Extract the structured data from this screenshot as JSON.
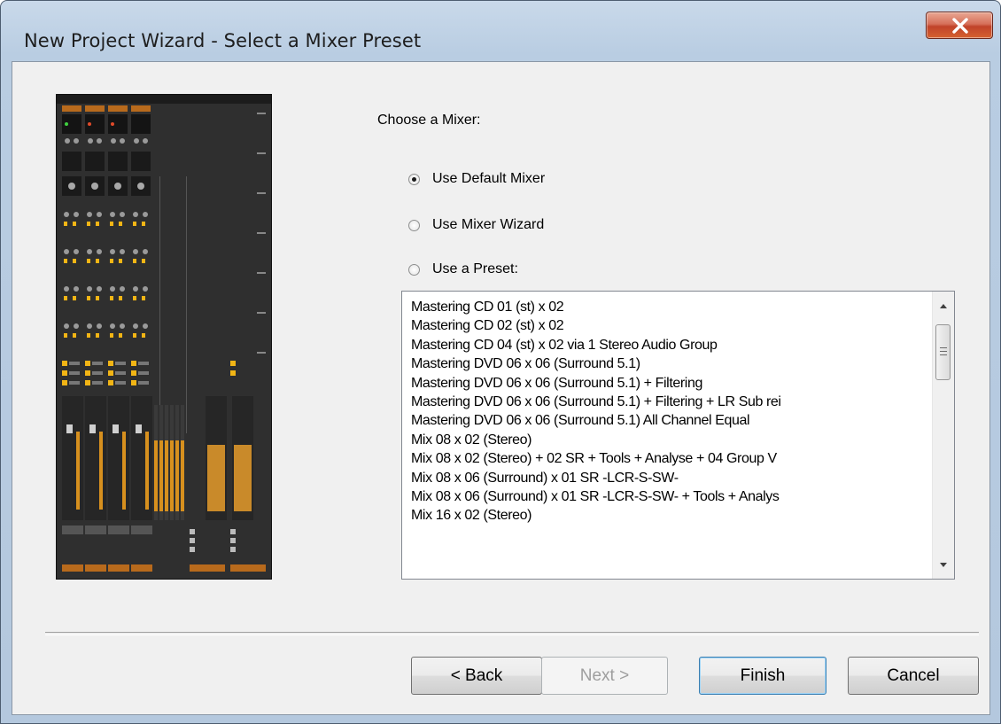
{
  "window": {
    "title": "New Project Wizard - Select a Mixer Preset",
    "close_glyph": "X"
  },
  "mixer": {
    "choose_label": "Choose a Mixer:",
    "options": [
      {
        "label": "Use Default Mixer",
        "checked": true
      },
      {
        "label": "Use Mixer Wizard",
        "checked": false
      },
      {
        "label": "Use a Preset:",
        "checked": false
      }
    ]
  },
  "presets": {
    "items": [
      "Mastering CD 01 (st) x 02",
      "Mastering CD 02 (st) x 02",
      "Mastering CD 04 (st) x 02 via 1 Stereo Audio Group",
      "Mastering DVD 06 x 06 (Surround 5.1)",
      "Mastering DVD 06 x 06 (Surround 5.1) + Filtering",
      "Mastering DVD 06 x 06 (Surround 5.1) + Filtering + LR Sub rei",
      "Mastering DVD 06 x 06 (Surround 5.1) All Channel Equal",
      "Mix 08 x 02 (Stereo)",
      "Mix 08 x 02 (Stereo) + 02 SR + Tools + Analyse + 04 Group V",
      "Mix 08 x 06 (Surround) x 01 SR -LCR-S-SW-",
      "Mix 08 x 06 (Surround) x 01 SR -LCR-S-SW- + Tools + Analys",
      "Mix 16 x 02 (Stereo)"
    ]
  },
  "buttons": {
    "back": "< Back",
    "next": "Next >",
    "finish": "Finish",
    "cancel": "Cancel"
  },
  "colors": {
    "titlebar": "#b9cde2",
    "close_button": "#c8502f",
    "dialog_bg": "#f0f0f0",
    "default_button_focus": "#3c7fb1"
  }
}
